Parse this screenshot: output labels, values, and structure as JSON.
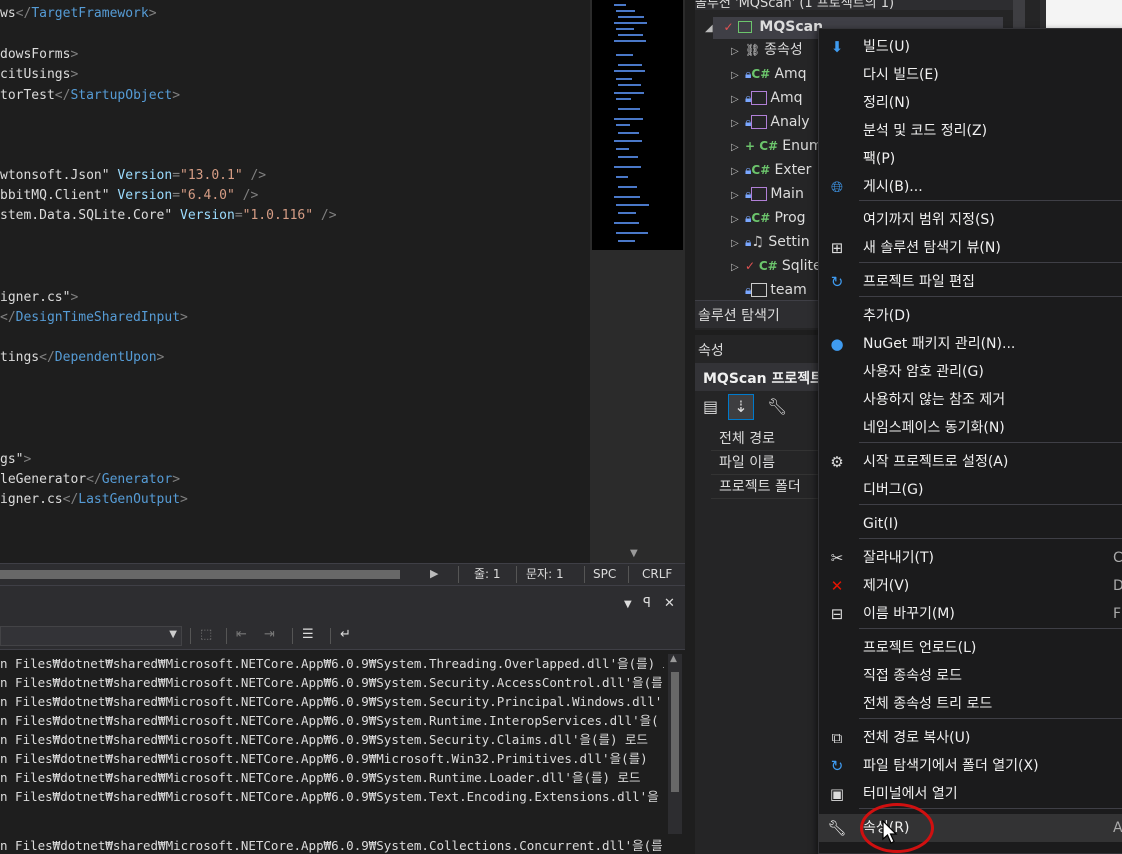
{
  "editor": {
    "lines": [
      {
        "parts": [
          [
            "txt",
            "ws"
          ],
          [
            "punct",
            "</"
          ],
          [
            "tag",
            "TargetFramework"
          ],
          [
            "punct",
            ">"
          ]
        ]
      },
      {
        "parts": [
          [
            "txt",
            "dowsForms"
          ],
          [
            "punct",
            ">"
          ]
        ]
      },
      {
        "parts": [
          [
            "txt",
            "citUsings"
          ],
          [
            "punct",
            ">"
          ]
        ]
      },
      {
        "parts": [
          [
            "txt",
            "torTest"
          ],
          [
            "punct",
            "</"
          ],
          [
            "tag",
            "StartupObject"
          ],
          [
            "punct",
            ">"
          ]
        ]
      },
      {
        "parts": [
          [
            "txt",
            "wtonsoft.Json\" "
          ],
          [
            "attr",
            "Version"
          ],
          [
            "punct",
            "="
          ],
          [
            "str",
            "\"13.0.1\""
          ],
          [
            "punct",
            " />"
          ]
        ]
      },
      {
        "parts": [
          [
            "txt",
            "bbitMQ.Client\" "
          ],
          [
            "attr",
            "Version"
          ],
          [
            "punct",
            "="
          ],
          [
            "str",
            "\"6.4.0\""
          ],
          [
            "punct",
            " />"
          ]
        ]
      },
      {
        "parts": [
          [
            "txt",
            "stem.Data.SQLite.Core\" "
          ],
          [
            "attr",
            "Version"
          ],
          [
            "punct",
            "="
          ],
          [
            "str",
            "\"1.0.116\""
          ],
          [
            "punct",
            " />"
          ]
        ]
      },
      {
        "parts": [
          [
            "txt",
            "igner.cs\""
          ],
          [
            "punct",
            ">"
          ]
        ]
      },
      {
        "parts": [
          [
            "punct",
            "</"
          ],
          [
            "tag",
            "DesignTimeSharedInput"
          ],
          [
            "punct",
            ">"
          ]
        ]
      },
      {
        "parts": [
          [
            "txt",
            "tings"
          ],
          [
            "punct",
            "</"
          ],
          [
            "tag",
            "DependentUpon"
          ],
          [
            "punct",
            ">"
          ]
        ]
      },
      {
        "parts": [
          [
            "txt",
            "gs\""
          ],
          [
            "punct",
            ">"
          ]
        ]
      },
      {
        "parts": [
          [
            "txt",
            "leGenerator"
          ],
          [
            "punct",
            "</"
          ],
          [
            "tag",
            "Generator"
          ],
          [
            "punct",
            ">"
          ]
        ]
      },
      {
        "parts": [
          [
            "txt",
            "igner.cs"
          ],
          [
            "punct",
            "</"
          ],
          [
            "tag",
            "LastGenOutput"
          ],
          [
            "punct",
            ">"
          ]
        ]
      }
    ],
    "status": {
      "col": "줄: 1",
      "char": "문자: 1",
      "spc": "SPC",
      "crlf": "CRLF"
    }
  },
  "output": {
    "lines": [
      "n Files₩dotnet₩shared₩Microsoft.NETCore.App₩6.0.9₩System.Threading.Overlapped.dll'을(를) 로",
      "n Files₩dotnet₩shared₩Microsoft.NETCore.App₩6.0.9₩System.Security.AccessControl.dll'을(를",
      "n Files₩dotnet₩shared₩Microsoft.NETCore.App₩6.0.9₩System.Security.Principal.Windows.dll'",
      "n Files₩dotnet₩shared₩Microsoft.NETCore.App₩6.0.9₩System.Runtime.InteropServices.dll'을(",
      "n Files₩dotnet₩shared₩Microsoft.NETCore.App₩6.0.9₩System.Security.Claims.dll'을(를) 로드",
      "n Files₩dotnet₩shared₩Microsoft.NETCore.App₩6.0.9₩Microsoft.Win32.Primitives.dll'을(를)",
      "n Files₩dotnet₩shared₩Microsoft.NETCore.App₩6.0.9₩System.Runtime.Loader.dll'을(를) 로드",
      "n Files₩dotnet₩shared₩Microsoft.NETCore.App₩6.0.9₩System.Text.Encoding.Extensions.dll'을",
      "n Files₩dotnet₩shared₩Microsoft.NETCore.App₩6.0.9₩System.Collections.Concurrent.dll'을(를"
    ]
  },
  "solution": {
    "top_title": "솔루션 'MQScan' (1 프로젝트의 1)",
    "project": "MQScan",
    "items": [
      {
        "label": "종속성",
        "icon": "dependencies-icon"
      },
      {
        "label": "Amq",
        "icon": "csharp-file-icon"
      },
      {
        "label": "Amq",
        "icon": "form-file-icon"
      },
      {
        "label": "Analy",
        "icon": "form-file-icon"
      },
      {
        "label": "Enum",
        "icon": "csharp-file-icon"
      },
      {
        "label": "Exter",
        "icon": "csharp-file-icon"
      },
      {
        "label": "Main",
        "icon": "form-file-icon"
      },
      {
        "label": "Prog",
        "icon": "csharp-file-icon"
      },
      {
        "label": "Settin",
        "icon": "settings-file-icon"
      },
      {
        "label": "Sqlite",
        "icon": "csharp-file-icon"
      },
      {
        "label": "team",
        "icon": "text-file-icon"
      }
    ],
    "tab": "솔루션 탐색기"
  },
  "properties": {
    "header": "속성",
    "object": "MQScan 프로젝트",
    "rows": [
      "전체 경로",
      "파일 이름",
      "프로젝트 폴더"
    ]
  },
  "context_menu": {
    "items": [
      {
        "label": "빌드(U)",
        "icon": "build-icon",
        "shortcut": ""
      },
      {
        "label": "다시 빌드(E)",
        "icon": "",
        "shortcut": ""
      },
      {
        "label": "정리(N)",
        "icon": "",
        "shortcut": ""
      },
      {
        "label": "분석 및 코드 정리(Z)",
        "icon": "",
        "shortcut": ""
      },
      {
        "label": "팩(P)",
        "icon": "",
        "shortcut": ""
      },
      {
        "label": "게시(B)...",
        "icon": "publish-globe-icon",
        "shortcut": ""
      },
      {
        "label": "여기까지 범위 지정(S)",
        "icon": "",
        "shortcut": ""
      },
      {
        "label": "새 솔루션 탐색기 뷰(N)",
        "icon": "new-view-icon",
        "shortcut": ""
      },
      {
        "label": "프로젝트 파일 편집",
        "icon": "edit-project-icon",
        "shortcut": ""
      },
      {
        "label": "추가(D)",
        "icon": "",
        "shortcut": ""
      },
      {
        "label": "NuGet 패키지 관리(N)...",
        "icon": "nuget-icon",
        "shortcut": ""
      },
      {
        "label": "사용자 암호 관리(G)",
        "icon": "",
        "shortcut": ""
      },
      {
        "label": "사용하지 않는 참조 제거",
        "icon": "",
        "shortcut": ""
      },
      {
        "label": "네임스페이스 동기화(N)",
        "icon": "",
        "shortcut": ""
      },
      {
        "label": "시작 프로젝트로 설정(A)",
        "icon": "gear-icon",
        "shortcut": ""
      },
      {
        "label": "디버그(G)",
        "icon": "",
        "shortcut": ""
      },
      {
        "label": "Git(I)",
        "icon": "",
        "shortcut": ""
      },
      {
        "label": "잘라내기(T)",
        "icon": "scissors-icon",
        "shortcut": "C"
      },
      {
        "label": "제거(V)",
        "icon": "delete-x-icon",
        "shortcut": "D"
      },
      {
        "label": "이름 바꾸기(M)",
        "icon": "rename-icon",
        "shortcut": "F"
      },
      {
        "label": "프로젝트 언로드(L)",
        "icon": "",
        "shortcut": ""
      },
      {
        "label": "직접 종속성 로드",
        "icon": "",
        "shortcut": ""
      },
      {
        "label": "전체 종속성 트리 로드",
        "icon": "",
        "shortcut": ""
      },
      {
        "label": "전체 경로 복사(U)",
        "icon": "copy-icon",
        "shortcut": ""
      },
      {
        "label": "파일 탐색기에서 폴더 열기(X)",
        "icon": "open-folder-arrow-icon",
        "shortcut": ""
      },
      {
        "label": "터미널에서 열기",
        "icon": "terminal-icon",
        "shortcut": ""
      },
      {
        "label": "속성(R)",
        "icon": "wrench-icon",
        "shortcut": "A"
      }
    ]
  },
  "colors": {
    "accent": "#007acc",
    "highlight_ring": "#d01010"
  }
}
